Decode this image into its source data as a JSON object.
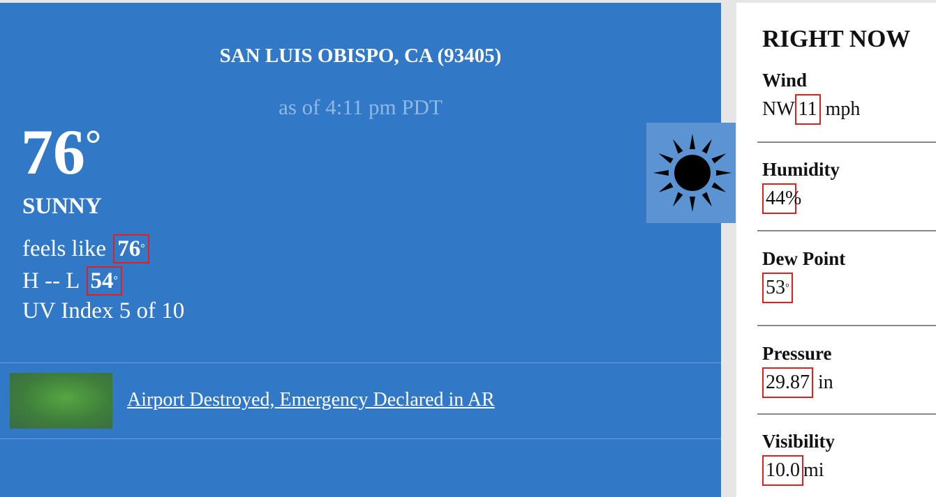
{
  "main": {
    "location": "SAN LUIS OBISPO, CA (93405)",
    "as_of": "as of 4:11 pm PDT",
    "temperature": "76",
    "degree_symbol": "°",
    "condition": "SUNNY",
    "feels_like_label": "feels like",
    "feels_like_value": "76",
    "high_low_label": "H -- L",
    "low_value": "54",
    "uv_index": "UV Index 5 of 10",
    "weather_icon": "sun-icon",
    "news": {
      "headline": "Airport Destroyed, Emergency Declared in AR"
    }
  },
  "side": {
    "title": "RIGHT NOW",
    "wind": {
      "label": "Wind",
      "direction": "NW",
      "value": "11",
      "unit": "mph"
    },
    "humidity": {
      "label": "Humidity",
      "value": "44",
      "unit": "%"
    },
    "dew_point": {
      "label": "Dew Point",
      "value": "53",
      "unit": "°"
    },
    "pressure": {
      "label": "Pressure",
      "value": "29.87",
      "unit": "in"
    },
    "visibility": {
      "label": "Visibility",
      "value": "10.0",
      "unit": "mi"
    }
  },
  "colors": {
    "panel_blue": "#3179c6",
    "highlight_red": "#e02020"
  }
}
